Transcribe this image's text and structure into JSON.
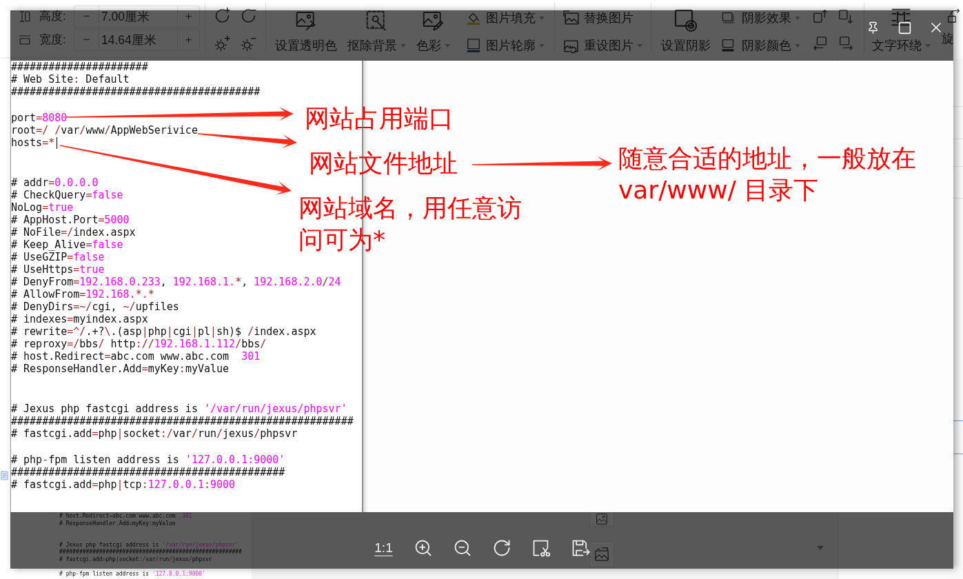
{
  "toolbar": {
    "size_fields": [
      {
        "label": "高度:",
        "minus": "−",
        "value": "7.00厘米",
        "plus": "+"
      },
      {
        "label": "宽度:",
        "minus": "−",
        "value": "14.64厘米",
        "plus": "+"
      }
    ],
    "tools": [
      {
        "label": "设置透明色",
        "dropdown": false
      },
      {
        "label": "抠除背景",
        "dropdown": true
      },
      {
        "label": "色彩",
        "dropdown": true
      },
      {
        "label": "图片填充",
        "dropdown": true
      },
      {
        "label": "图片轮廓",
        "dropdown": true
      },
      {
        "label": "替换图片",
        "dropdown": false
      },
      {
        "label": "重设图片",
        "dropdown": true
      },
      {
        "label": "设置阴影",
        "dropdown": false
      },
      {
        "label": "阴影效果",
        "dropdown": true
      },
      {
        "label": "阴影颜色",
        "dropdown": true
      },
      {
        "label": "文字环绕",
        "dropdown": true
      },
      {
        "label": "旋",
        "dropdown": false
      }
    ]
  },
  "viewer": {
    "image": {
      "editor_lines": [
        {
          "kind": "code",
          "cursor": false,
          "tokens": [
            {
              "kind": "plain",
              "text": "######################"
            }
          ]
        },
        {
          "kind": "code",
          "cursor": false,
          "tokens": [
            {
              "kind": "plain",
              "text": "# Web Site"
            },
            {
              "kind": "op",
              "text": ":"
            },
            {
              "kind": "plain",
              "text": " Default"
            }
          ]
        },
        {
          "kind": "code",
          "cursor": false,
          "tokens": [
            {
              "kind": "plain",
              "text": "########################################"
            }
          ]
        },
        {
          "kind": "blank"
        },
        {
          "kind": "code",
          "cursor": false,
          "tokens": [
            {
              "kind": "plain",
              "text": "port"
            },
            {
              "kind": "op",
              "text": "="
            },
            {
              "kind": "value",
              "text": "8080"
            }
          ]
        },
        {
          "kind": "code",
          "cursor": false,
          "tokens": [
            {
              "kind": "plain",
              "text": "root"
            },
            {
              "kind": "op",
              "text": "=/ /"
            },
            {
              "kind": "plain",
              "text": "var"
            },
            {
              "kind": "op",
              "text": "/"
            },
            {
              "kind": "plain",
              "text": "www"
            },
            {
              "kind": "op",
              "text": "/"
            },
            {
              "kind": "plain",
              "text": "AppWebSerivice"
            }
          ]
        },
        {
          "kind": "code",
          "cursor": true,
          "tokens": [
            {
              "kind": "plain",
              "text": "hosts"
            },
            {
              "kind": "op",
              "text": "=*"
            }
          ]
        },
        {
          "kind": "blank"
        },
        {
          "kind": "blank"
        },
        {
          "kind": "code",
          "cursor": false,
          "tokens": [
            {
              "kind": "plain",
              "text": "# addr"
            },
            {
              "kind": "op",
              "text": "="
            },
            {
              "kind": "value",
              "text": "0.0.0.0"
            }
          ]
        },
        {
          "kind": "code",
          "cursor": false,
          "tokens": [
            {
              "kind": "plain",
              "text": "# CheckQuery"
            },
            {
              "kind": "op",
              "text": "="
            },
            {
              "kind": "value",
              "text": "false"
            }
          ]
        },
        {
          "kind": "code",
          "cursor": false,
          "tokens": [
            {
              "kind": "plain",
              "text": "NoLog"
            },
            {
              "kind": "op",
              "text": "="
            },
            {
              "kind": "value",
              "text": "true"
            }
          ]
        },
        {
          "kind": "code",
          "cursor": false,
          "tokens": [
            {
              "kind": "plain",
              "text": "# AppHost.Port"
            },
            {
              "kind": "op",
              "text": "="
            },
            {
              "kind": "value",
              "text": "5000"
            }
          ]
        },
        {
          "kind": "code",
          "cursor": false,
          "tokens": [
            {
              "kind": "plain",
              "text": "# NoFile"
            },
            {
              "kind": "op",
              "text": "=/"
            },
            {
              "kind": "plain",
              "text": "index.aspx"
            }
          ]
        },
        {
          "kind": "code",
          "cursor": false,
          "tokens": [
            {
              "kind": "plain",
              "text": "# Keep_Alive"
            },
            {
              "kind": "op",
              "text": "="
            },
            {
              "kind": "value",
              "text": "false"
            }
          ]
        },
        {
          "kind": "code",
          "cursor": false,
          "tokens": [
            {
              "kind": "plain",
              "text": "# UseGZIP"
            },
            {
              "kind": "op",
              "text": "="
            },
            {
              "kind": "value",
              "text": "false"
            }
          ]
        },
        {
          "kind": "code",
          "cursor": false,
          "tokens": [
            {
              "kind": "plain",
              "text": "# UseHttps"
            },
            {
              "kind": "op",
              "text": "="
            },
            {
              "kind": "value",
              "text": "true"
            }
          ]
        },
        {
          "kind": "code",
          "cursor": false,
          "tokens": [
            {
              "kind": "plain",
              "text": "# DenyFrom"
            },
            {
              "kind": "op",
              "text": "="
            },
            {
              "kind": "value",
              "text": "192.168.0.233"
            },
            {
              "kind": "plain",
              "text": ", "
            },
            {
              "kind": "value",
              "text": "192.168.1."
            },
            {
              "kind": "op",
              "text": "*"
            },
            {
              "kind": "plain",
              "text": ", "
            },
            {
              "kind": "value",
              "text": "192.168.2.0"
            },
            {
              "kind": "op",
              "text": "/"
            },
            {
              "kind": "value",
              "text": "24"
            }
          ]
        },
        {
          "kind": "code",
          "cursor": false,
          "tokens": [
            {
              "kind": "plain",
              "text": "# AllowFrom"
            },
            {
              "kind": "op",
              "text": "="
            },
            {
              "kind": "value",
              "text": "192.168."
            },
            {
              "kind": "op",
              "text": "*"
            },
            {
              "kind": "value",
              "text": "."
            },
            {
              "kind": "op",
              "text": "*"
            }
          ]
        },
        {
          "kind": "code",
          "cursor": false,
          "tokens": [
            {
              "kind": "plain",
              "text": "# DenyDirs"
            },
            {
              "kind": "op",
              "text": "=~/"
            },
            {
              "kind": "plain",
              "text": "cgi, "
            },
            {
              "kind": "op",
              "text": "~/"
            },
            {
              "kind": "plain",
              "text": "upfiles"
            }
          ]
        },
        {
          "kind": "code",
          "cursor": false,
          "tokens": [
            {
              "kind": "plain",
              "text": "# indexes"
            },
            {
              "kind": "op",
              "text": "="
            },
            {
              "kind": "plain",
              "text": "myindex.aspx"
            }
          ]
        },
        {
          "kind": "code",
          "cursor": false,
          "tokens": [
            {
              "kind": "plain",
              "text": "# rewrite"
            },
            {
              "kind": "op",
              "text": "=^/"
            },
            {
              "kind": "plain",
              "text": ".+?"
            },
            {
              "kind": "op",
              "text": "\\"
            },
            {
              "kind": "plain",
              "text": ".(asp"
            },
            {
              "kind": "op",
              "text": "|"
            },
            {
              "kind": "plain",
              "text": "php"
            },
            {
              "kind": "op",
              "text": "|"
            },
            {
              "kind": "plain",
              "text": "cgi"
            },
            {
              "kind": "op",
              "text": "|"
            },
            {
              "kind": "plain",
              "text": "pl"
            },
            {
              "kind": "op",
              "text": "|"
            },
            {
              "kind": "plain",
              "text": "sh)$ "
            },
            {
              "kind": "op",
              "text": "/"
            },
            {
              "kind": "plain",
              "text": "index.aspx"
            }
          ]
        },
        {
          "kind": "code",
          "cursor": false,
          "tokens": [
            {
              "kind": "plain",
              "text": "# reproxy"
            },
            {
              "kind": "op",
              "text": "=/"
            },
            {
              "kind": "plain",
              "text": "bbs"
            },
            {
              "kind": "op",
              "text": "/"
            },
            {
              "kind": "plain",
              "text": " http"
            },
            {
              "kind": "op",
              "text": "://"
            },
            {
              "kind": "value",
              "text": "192.168.1.112"
            },
            {
              "kind": "op",
              "text": "/"
            },
            {
              "kind": "plain",
              "text": "bbs"
            },
            {
              "kind": "op",
              "text": "/"
            }
          ]
        },
        {
          "kind": "code",
          "cursor": false,
          "tokens": [
            {
              "kind": "plain",
              "text": "# host.Redirect"
            },
            {
              "kind": "op",
              "text": "="
            },
            {
              "kind": "plain",
              "text": "abc.com www.abc.com  "
            },
            {
              "kind": "value",
              "text": "301"
            }
          ]
        },
        {
          "kind": "code",
          "cursor": false,
          "tokens": [
            {
              "kind": "plain",
              "text": "# ResponseHandler.Add"
            },
            {
              "kind": "op",
              "text": "="
            },
            {
              "kind": "plain",
              "text": "myKey"
            },
            {
              "kind": "op",
              "text": ":"
            },
            {
              "kind": "plain",
              "text": "myValue"
            }
          ]
        },
        {
          "kind": "blank"
        },
        {
          "kind": "blank"
        },
        {
          "kind": "code",
          "cursor": false,
          "tokens": [
            {
              "kind": "plain",
              "text": "# Jexus php fastcgi address is "
            },
            {
              "kind": "value",
              "text": "'/var/run/jexus/phpsvr'"
            }
          ]
        },
        {
          "kind": "code",
          "cursor": false,
          "tokens": [
            {
              "kind": "plain",
              "text": "#######################################################"
            }
          ]
        },
        {
          "kind": "code",
          "cursor": false,
          "tokens": [
            {
              "kind": "plain",
              "text": "# fastcgi.add"
            },
            {
              "kind": "op",
              "text": "="
            },
            {
              "kind": "plain",
              "text": "php"
            },
            {
              "kind": "op",
              "text": "|"
            },
            {
              "kind": "plain",
              "text": "socket"
            },
            {
              "kind": "op",
              "text": ":/"
            },
            {
              "kind": "plain",
              "text": "var"
            },
            {
              "kind": "op",
              "text": "/"
            },
            {
              "kind": "plain",
              "text": "run"
            },
            {
              "kind": "op",
              "text": "/"
            },
            {
              "kind": "plain",
              "text": "jexus"
            },
            {
              "kind": "op",
              "text": "/"
            },
            {
              "kind": "plain",
              "text": "phpsvr"
            }
          ]
        },
        {
          "kind": "blank"
        },
        {
          "kind": "code",
          "cursor": false,
          "tokens": [
            {
              "kind": "plain",
              "text": "# php"
            },
            {
              "kind": "op",
              "text": "-"
            },
            {
              "kind": "plain",
              "text": "fpm listen address is "
            },
            {
              "kind": "value",
              "text": "'127.0.0.1:9000'"
            }
          ]
        },
        {
          "kind": "code",
          "cursor": false,
          "tokens": [
            {
              "kind": "plain",
              "text": "############################################"
            }
          ]
        },
        {
          "kind": "code",
          "cursor": false,
          "tokens": [
            {
              "kind": "plain",
              "text": "# fastcgi.add"
            },
            {
              "kind": "op",
              "text": "="
            },
            {
              "kind": "plain",
              "text": "php"
            },
            {
              "kind": "op",
              "text": "|"
            },
            {
              "kind": "plain",
              "text": "tcp"
            },
            {
              "kind": "op",
              "text": ":"
            },
            {
              "kind": "value",
              "text": "127.0.0.1"
            },
            {
              "kind": "op",
              "text": ":"
            },
            {
              "kind": "value",
              "text": "9000"
            }
          ]
        }
      ],
      "annotations": [
        {
          "lines": [
            "网站占用端口"
          ]
        },
        {
          "lines": [
            "网站文件地址"
          ]
        },
        {
          "lines": [
            "随意合适的地址，一般放在",
            "var/www/ 目录下"
          ]
        },
        {
          "lines": [
            "网站域名，用任意访",
            "问可为*"
          ]
        }
      ]
    },
    "toolbar": {
      "actual_size": "1:1"
    }
  },
  "document": {
    "lines": [
      {
        "kind": "code",
        "tokens": [
          {
            "kind": "plain",
            "text": "# host.Redirect"
          },
          {
            "kind": "op",
            "text": "="
          },
          {
            "kind": "plain",
            "text": "abc.com www.abc.com  "
          },
          {
            "kind": "value",
            "text": "301"
          }
        ]
      },
      {
        "kind": "code",
        "tokens": [
          {
            "kind": "plain",
            "text": "# ResponseHandler.Add"
          },
          {
            "kind": "op",
            "text": "="
          },
          {
            "kind": "plain",
            "text": "myKey"
          },
          {
            "kind": "op",
            "text": ":"
          },
          {
            "kind": "plain",
            "text": "myValue"
          }
        ]
      },
      {
        "kind": "blank"
      },
      {
        "kind": "blank"
      },
      {
        "kind": "code",
        "tokens": [
          {
            "kind": "plain",
            "text": "# Jexus php fastcgi address is "
          },
          {
            "kind": "value",
            "text": "'/var/run/jexus/phpsvr'"
          }
        ]
      },
      {
        "kind": "code",
        "tokens": [
          {
            "kind": "plain",
            "text": "#######################################################"
          }
        ]
      },
      {
        "kind": "code",
        "tokens": [
          {
            "kind": "plain",
            "text": "# fastcgi.add"
          },
          {
            "kind": "op",
            "text": "="
          },
          {
            "kind": "plain",
            "text": "php"
          },
          {
            "kind": "op",
            "text": "|"
          },
          {
            "kind": "plain",
            "text": "socket"
          },
          {
            "kind": "op",
            "text": ":/"
          },
          {
            "kind": "plain",
            "text": "var"
          },
          {
            "kind": "op",
            "text": "/"
          },
          {
            "kind": "plain",
            "text": "run"
          },
          {
            "kind": "op",
            "text": "/"
          },
          {
            "kind": "plain",
            "text": "jexus"
          },
          {
            "kind": "op",
            "text": "/"
          },
          {
            "kind": "plain",
            "text": "phpsvr"
          }
        ]
      },
      {
        "kind": "blank"
      },
      {
        "kind": "code",
        "tokens": [
          {
            "kind": "plain",
            "text": "# php"
          },
          {
            "kind": "op",
            "text": "-"
          },
          {
            "kind": "plain",
            "text": "fpm listen address is "
          },
          {
            "kind": "value",
            "text": "'127.0.0.1:9000'"
          }
        ]
      }
    ]
  }
}
